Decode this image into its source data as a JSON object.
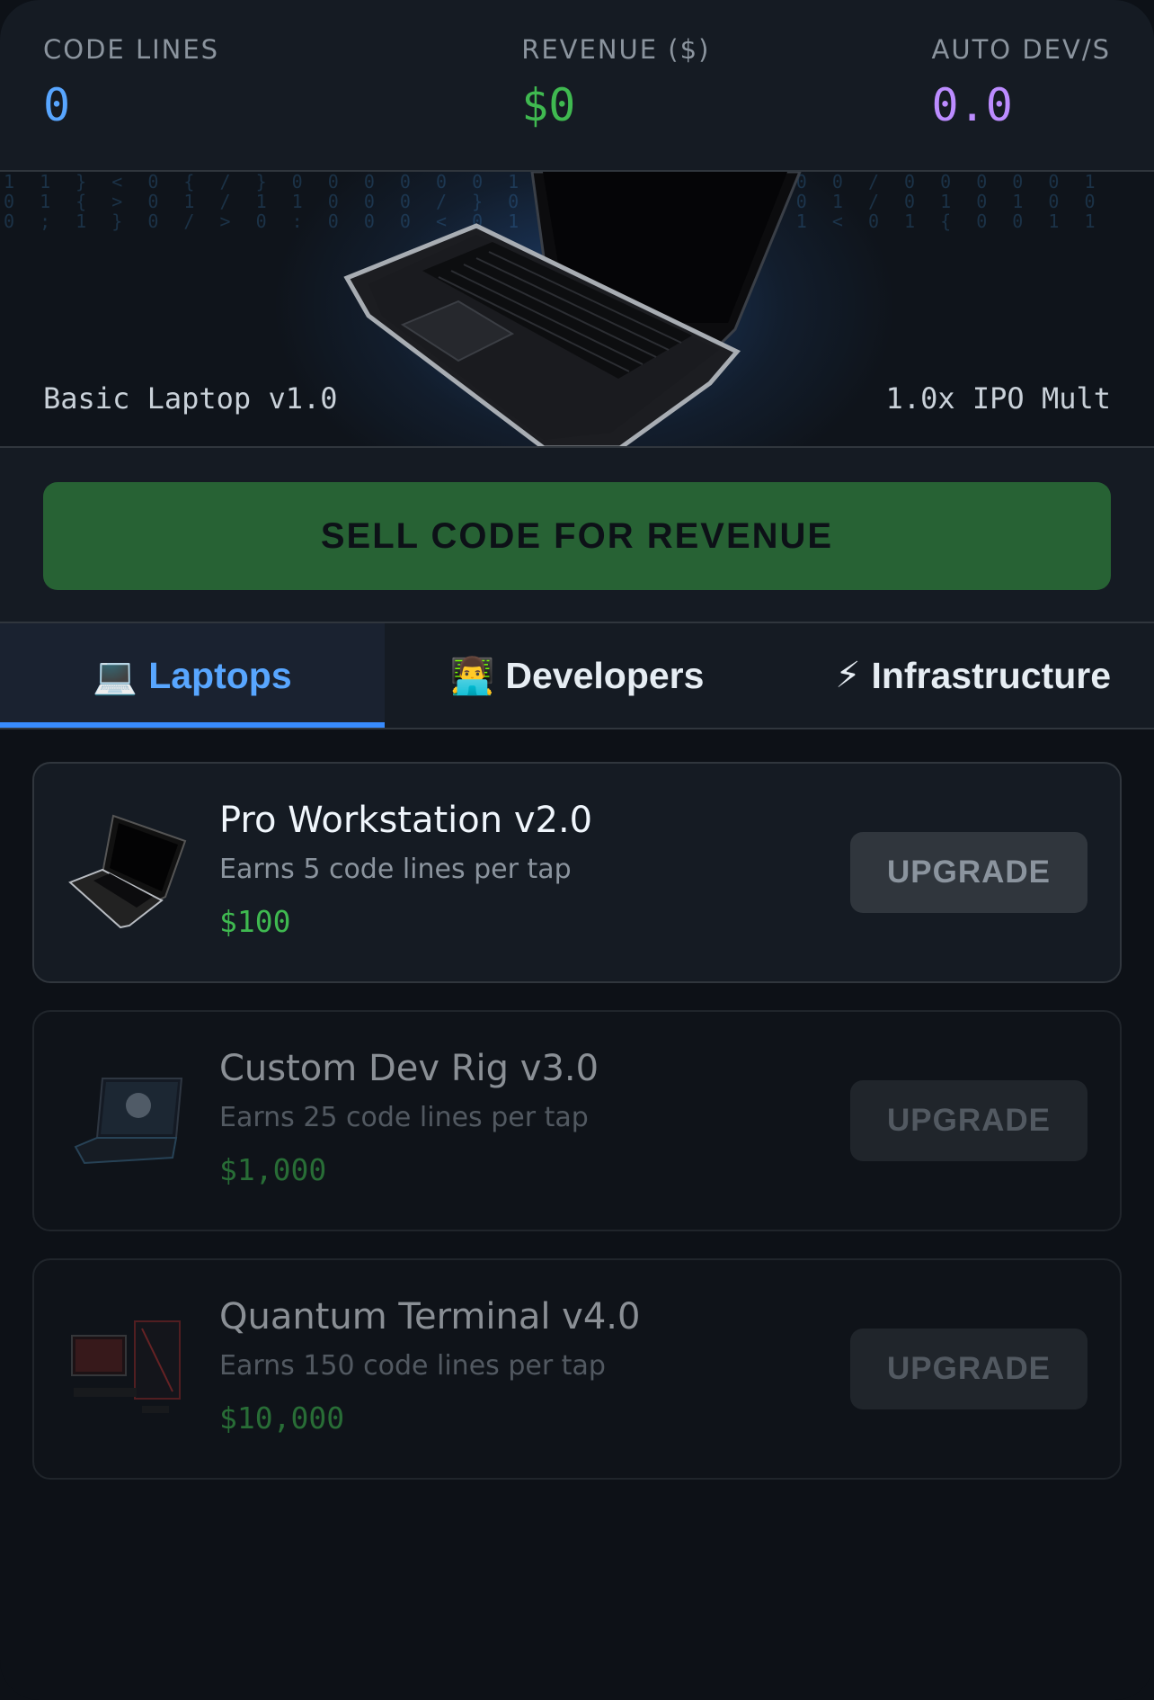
{
  "stats": [
    {
      "label": "CODE LINES",
      "value": "0"
    },
    {
      "label": "REVENUE ($)",
      "value": "$0"
    },
    {
      "label": "AUTO DEV/S",
      "value": "0.0"
    }
  ],
  "hero": {
    "machine": "Basic Laptop v1.0",
    "multiplier": "1.0x IPO Mult",
    "image": "laptop-image"
  },
  "sell_button": "SELL CODE FOR REVENUE",
  "tabs": [
    {
      "icon": "💻",
      "label": "Laptops",
      "active": true
    },
    {
      "icon": "👨‍💻",
      "label": "Developers",
      "active": false
    },
    {
      "icon": "⚡",
      "label": "Infrastructure",
      "active": false
    }
  ],
  "upgrades": [
    {
      "title": "Pro Workstation v2.0",
      "desc": "Earns 5 code lines per tap",
      "price": "$100",
      "button": "UPGRADE",
      "image": "laptop-image",
      "affordable": true
    },
    {
      "title": "Custom Dev Rig v3.0",
      "desc": "Earns 25 code lines per tap",
      "price": "$1,000",
      "button": "UPGRADE",
      "image": "gaming-laptop-image",
      "affordable": false
    },
    {
      "title": "Quantum Terminal v4.0",
      "desc": "Earns 150 code lines per tap",
      "price": "$10,000",
      "button": "UPGRADE",
      "image": "desktop-pc-image",
      "affordable": false
    }
  ],
  "colors": {
    "code_lines": "#58a6ff",
    "revenue": "#3fb950",
    "auto_dev": "#bc8cff",
    "sell_button": "#276234",
    "active_tab": "#58a6ff"
  }
}
